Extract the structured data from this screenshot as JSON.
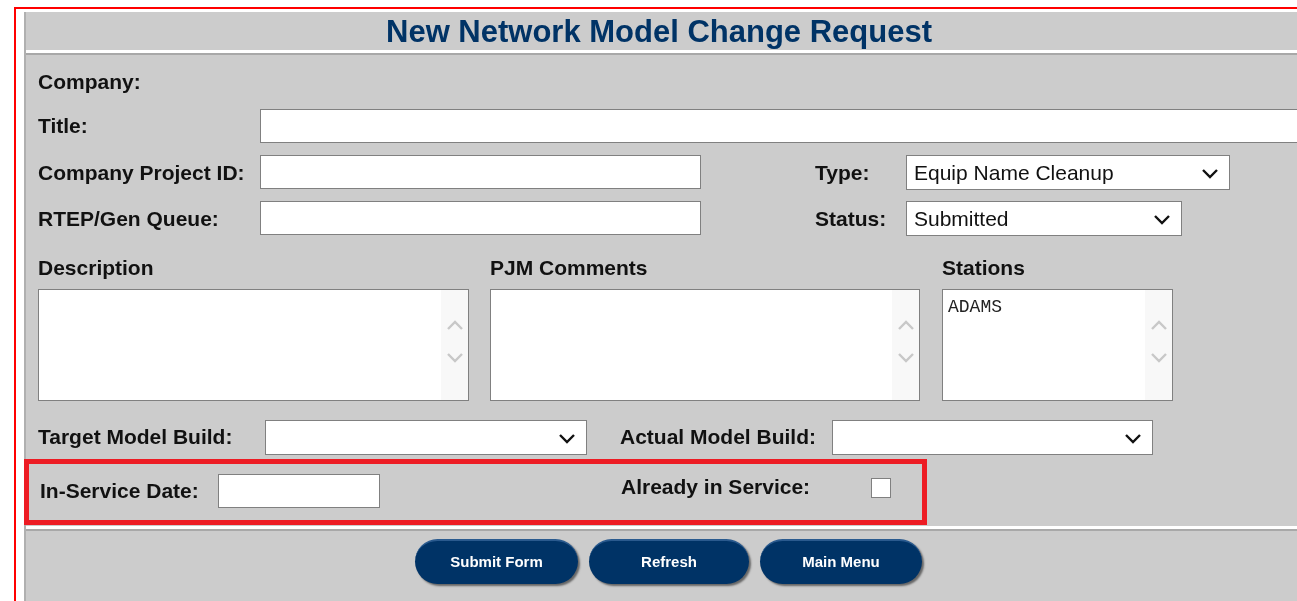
{
  "title": "New Network Model Change Request",
  "company": {
    "label": "Company:"
  },
  "title_field": {
    "label": "Title:"
  },
  "project_id": {
    "label": "Company Project ID:"
  },
  "type": {
    "label": "Type:",
    "value": "Equip Name Cleanup"
  },
  "rtep": {
    "label": "RTEP/Gen Queue:"
  },
  "status": {
    "label": "Status:",
    "value": "Submitted"
  },
  "text_areas": [
    {
      "label": "Description"
    },
    {
      "label": "PJM Comments"
    },
    {
      "label": "Stations",
      "value": "ADAMS"
    }
  ],
  "target_build": {
    "label": "Target Model Build:"
  },
  "actual_build": {
    "label": "Actual Model Build:"
  },
  "in_service_date": {
    "label": "In-Service Date:"
  },
  "already_in_service": {
    "label": "Already in Service:",
    "checked": false
  },
  "buttons": [
    "Submit Form",
    "Refresh",
    "Main Menu"
  ]
}
